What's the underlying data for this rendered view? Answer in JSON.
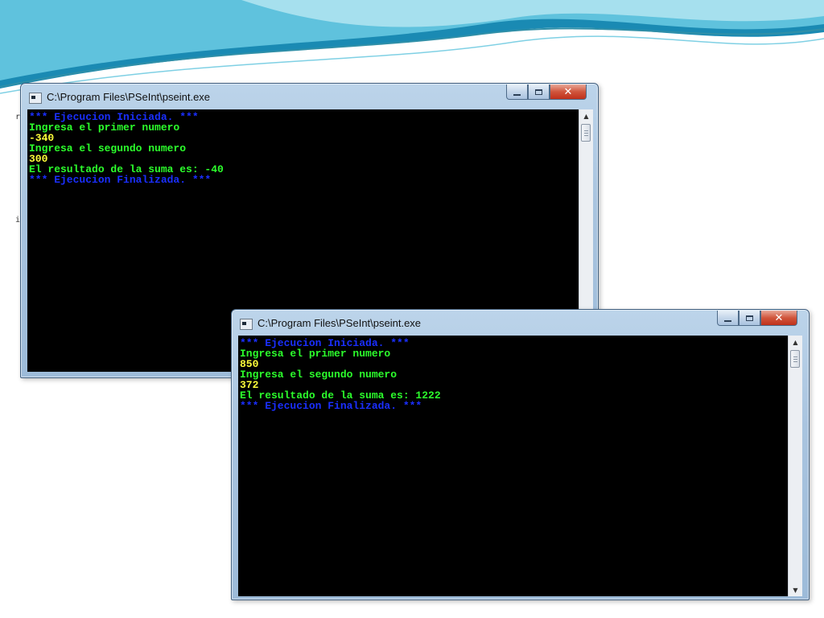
{
  "background": {
    "wave_colors": [
      "#1a8ab3",
      "#5fc2dd",
      "#a6e0ee",
      "#2f8fa8"
    ]
  },
  "windows": [
    {
      "title": "C:\\Program Files\\PSeInt\\pseint.exe",
      "icon": "console-app-icon",
      "controls": {
        "minimize": "minimize-icon",
        "maximize": "maximize-icon",
        "close": "✕"
      },
      "lines": [
        {
          "text": "*** Ejecucion Iniciada. ***",
          "color": "blue"
        },
        {
          "text": "Ingresa el primer numero",
          "color": "green"
        },
        {
          "text": "-340",
          "color": "yellow"
        },
        {
          "text": "Ingresa el segundo numero",
          "color": "green"
        },
        {
          "text": "300",
          "color": "yellow"
        },
        {
          "text": "El resultado de la suma es: -40",
          "color": "green"
        },
        {
          "text": "*** Ejecucion Finalizada. ***",
          "color": "blue"
        }
      ]
    },
    {
      "title": "C:\\Program Files\\PSeInt\\pseint.exe",
      "icon": "console-app-icon",
      "controls": {
        "minimize": "minimize-icon",
        "maximize": "maximize-icon",
        "close": "✕"
      },
      "lines": [
        {
          "text": "*** Ejecucion Iniciada. ***",
          "color": "blue"
        },
        {
          "text": "Ingresa el primer numero",
          "color": "green"
        },
        {
          "text": "850",
          "color": "yellow"
        },
        {
          "text": "Ingresa el segundo numero",
          "color": "green"
        },
        {
          "text": "372",
          "color": "yellow"
        },
        {
          "text": "El resultado de la suma es: 1222",
          "color": "green"
        },
        {
          "text": "*** Ejecucion Finalizada. ***",
          "color": "blue"
        }
      ]
    }
  ],
  "colors": {
    "blue": "#1a2fff",
    "green": "#2cff2c",
    "yellow": "#ffff3a",
    "console_bg": "#000000"
  }
}
